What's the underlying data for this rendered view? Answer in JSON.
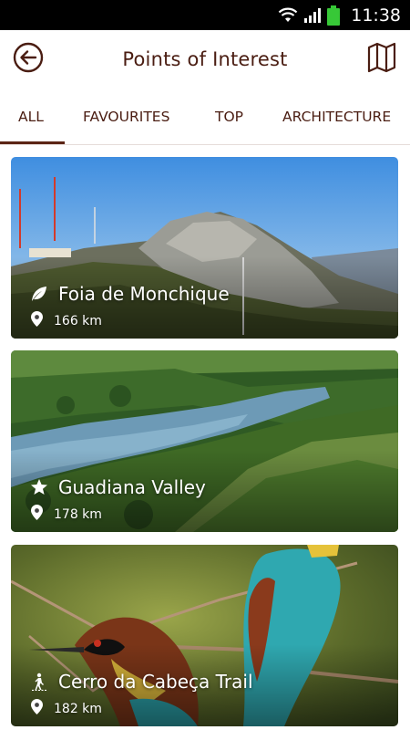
{
  "status_bar": {
    "time": "11:38",
    "icons": [
      "wifi-icon",
      "signal-icon",
      "battery-icon"
    ]
  },
  "header": {
    "title": "Points of Interest",
    "back_icon": "back-arrow-icon",
    "map_icon": "map-icon"
  },
  "tabs": [
    {
      "label": "ALL",
      "selected": true
    },
    {
      "label": "FAVOURITES",
      "selected": false
    },
    {
      "label": "TOP",
      "selected": false
    },
    {
      "label": "ARCHITECTURE",
      "selected": false
    }
  ],
  "cards": [
    {
      "title": "Foia de Monchique",
      "distance": "166 km",
      "category_icon": "leaf-icon",
      "image": "mountain-photo"
    },
    {
      "title": "Guadiana Valley",
      "distance": "178 km",
      "category_icon": "star-icon",
      "image": "river-valley-photo"
    },
    {
      "title": "Cerro da Cabeça Trail",
      "distance": "182 km",
      "category_icon": "hiker-icon",
      "image": "bee-eater-birds-photo"
    }
  ],
  "colors": {
    "brand": "#4a1d12",
    "tab_indicator": "#5b2415",
    "status_bar": "#000000",
    "battery": "#37c837"
  }
}
